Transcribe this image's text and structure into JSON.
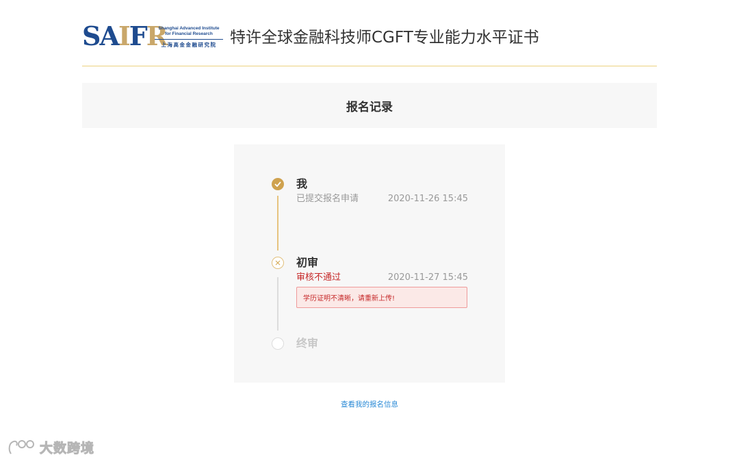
{
  "header": {
    "logo": {
      "mark": "SAIFR",
      "en_line1": "Shanghai Advanced Institute",
      "en_line2": "for Financial Research",
      "cn": "上海高金金融研究院"
    },
    "title": "特许全球金融科技师CGFT专业能力水平证书"
  },
  "colors": {
    "gold": "#cfa24f",
    "reject_red": "#c62828",
    "link_blue": "#2a8ad6"
  },
  "page_title": "报名记录",
  "steps": [
    {
      "title": "我",
      "status": "已提交报名申请",
      "time": "2020-11-26 15:45",
      "icon": "check-icon"
    },
    {
      "title": "初审",
      "status": "审核不通过",
      "time": "2020-11-27 15:45",
      "note": "学历证明不清晰，请重新上传!",
      "icon": "x-icon"
    },
    {
      "title": "终审",
      "icon": "empty-circle-icon"
    }
  ],
  "link_text": "查看我的报名信息",
  "watermark": "大数跨境"
}
